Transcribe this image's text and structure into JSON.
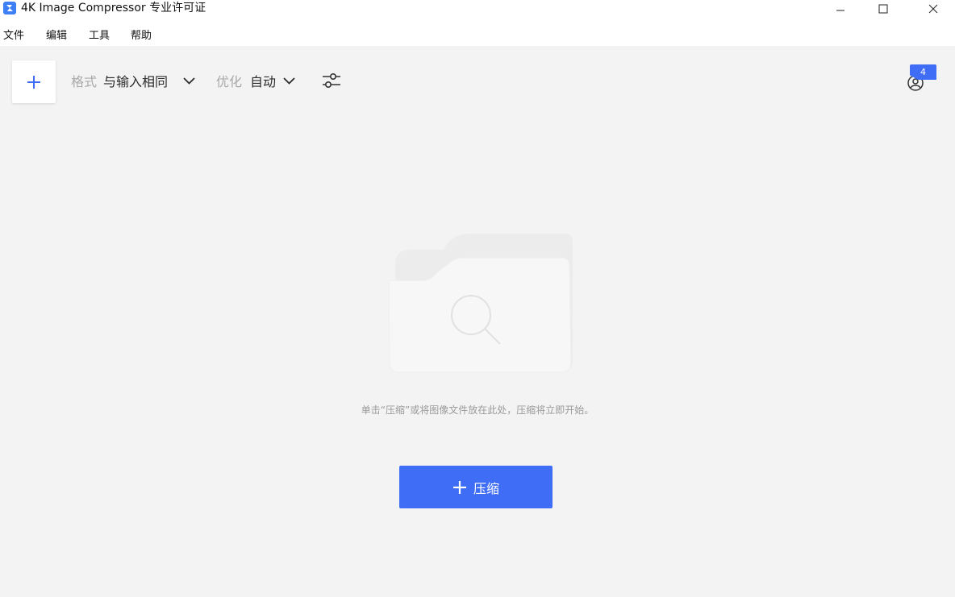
{
  "window": {
    "title": "4K Image Compressor 专业许可证",
    "icon": "app-logo-icon",
    "controls": [
      "minimize-icon",
      "maximize-icon",
      "close-icon"
    ]
  },
  "menu": {
    "items": [
      {
        "label": "文件"
      },
      {
        "label": "编辑"
      },
      {
        "label": "工具"
      },
      {
        "label": "帮助"
      }
    ]
  },
  "toolbar": {
    "add_icon": "plus-icon",
    "format_label": "格式",
    "format_value": "与输入相同",
    "optimize_label": "优化",
    "optimize_value": "自动",
    "settings_icon": "sliders-icon"
  },
  "account": {
    "icon": "user-icon",
    "badge": "4"
  },
  "empty_state": {
    "illustration": "folder-search-icon",
    "hint": "单击“压缩”或将图像文件放在此处，压缩将立即开始。",
    "button_label": "压缩"
  },
  "colors": {
    "accent": "#3f6df5",
    "background": "#f3f3f3",
    "label_grey": "#a9a9a9"
  }
}
